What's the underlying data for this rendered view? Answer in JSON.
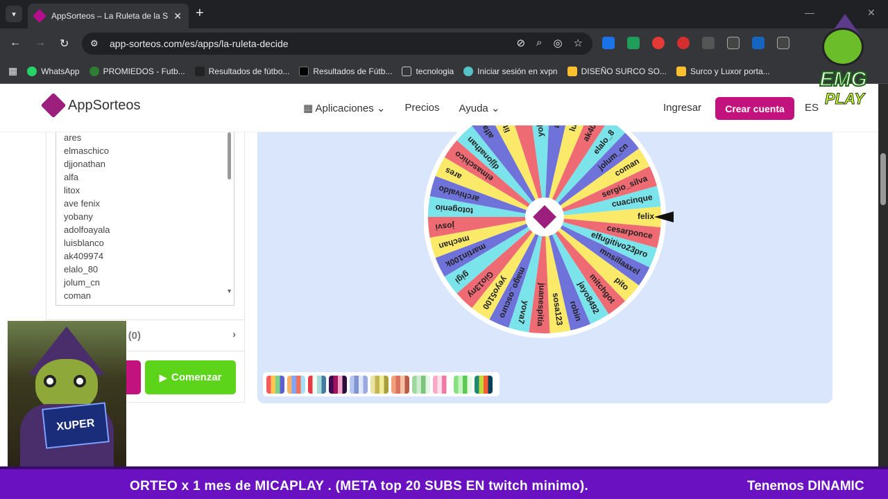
{
  "browser": {
    "tab_title": "AppSorteos – La Ruleta de la Su",
    "url": "app-sorteos.com/es/apps/la-ruleta-decide",
    "bookmarks": [
      "WhatsApp",
      "PROMIEDOS - Futb...",
      "Resultados de fútbo...",
      "Resultados de Fútb...",
      "tecnologia",
      "Iniciar sesión en xvpn",
      "DISEÑO SURCO SO...",
      "Surco y Luxor porta..."
    ]
  },
  "header": {
    "logo": "AppSorteos",
    "nav": [
      "Aplicaciones",
      "Precios",
      "Ayuda"
    ],
    "login": "Ingresar",
    "signup": "Crear cuenta",
    "lang": "ES"
  },
  "participants": [
    "ares",
    "elmaschico",
    "djjonathan",
    "alfa",
    "litox",
    "ave fenix",
    "yobany",
    "adolfoayala",
    "luisblanco",
    "ak409974",
    "elalo_80",
    "jolum_cn",
    "coman",
    "sergio_silva"
  ],
  "results": {
    "label": "tas",
    "count": "(0)"
  },
  "start_label": "Comenzar",
  "wheel": {
    "segments": [
      "felix",
      "cesarponce",
      "elfugitivo23pro",
      "mnsillaaxel",
      "pito",
      "mitchgot",
      "jayo8492",
      "robin",
      "sosa123",
      "juanespitia",
      "yova7",
      "mago_oscuro",
      "yeyo5100",
      "Gio13ny",
      "gigi",
      "martin100k",
      "mechan",
      "josvi",
      "totogenio",
      "archivaldo",
      "ares",
      "elmaschico",
      "djjonathan",
      "alfa",
      "litox",
      "ave",
      "yobany",
      "adolf",
      "luisb",
      "ak409",
      "elalo_8",
      "jolum_cn",
      "coman",
      "sergio_silva",
      "cuacinque"
    ],
    "colors": [
      "#fbe96a",
      "#ef6b73",
      "#7be3ea",
      "#6f72d8"
    ]
  },
  "palette_swatches": [
    [
      "#f65a5a",
      "#f9c74f",
      "#7bd389",
      "#5e60ce"
    ],
    [
      "#f7b267",
      "#7aa7ff",
      "#f27059",
      "#a9def9"
    ],
    [
      "#e63946",
      "#f1faee",
      "#a8dadc",
      "#457b9d"
    ],
    [
      "#3d0c4f",
      "#a0135f",
      "#f3a6c8",
      "#2b0f3a"
    ],
    [
      "#b8c6f0",
      "#7f95d1",
      "#dfe7fd",
      "#9aa9e0"
    ],
    [
      "#e9e4a6",
      "#c4b454",
      "#f1ec9a",
      "#a89f3a"
    ],
    [
      "#f2a07b",
      "#d9735f",
      "#f6c3a6",
      "#b65c48"
    ],
    [
      "#9ed8a0",
      "#cdeccd",
      "#7cc47e",
      "#e5f5e5"
    ],
    [
      "#f9a8c7",
      "#fde2ec",
      "#f478a6",
      "#ffffff"
    ],
    [
      "#86e07f",
      "#c7f3c3",
      "#5cc955",
      "#e4fae2"
    ],
    [
      "#1f8a70",
      "#bedb39",
      "#ff5a33",
      "#004358"
    ]
  ],
  "avatar": {
    "brand": "XUPER"
  },
  "overlay_logo": {
    "line1": "EMG",
    "line2": "PLAY"
  },
  "ticker": {
    "text": "ORTEO x 1 mes de MICAPLAY .  (META  top 20 SUBS  EN  twitch minimo).",
    "text2": "Tenemos DINAMIC"
  }
}
